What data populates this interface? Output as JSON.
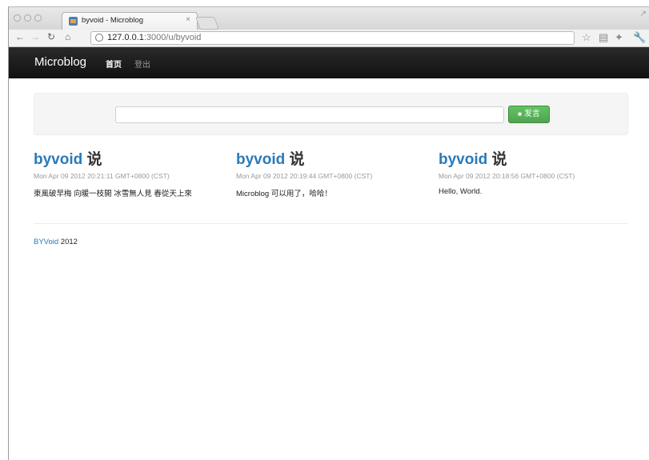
{
  "browser": {
    "tab_title": "byvoid - Microblog",
    "tab_close": "×",
    "url_host": "127.0.0.1",
    "url_rest": ":3000/u/byvoid"
  },
  "site": {
    "brand": "Microblog",
    "nav": {
      "home": "首页",
      "logout": "登出"
    },
    "composer": {
      "input_value": "",
      "submit_label": "发言"
    },
    "posts": [
      {
        "user": "byvoid",
        "verb": "说",
        "time": "Mon Apr 09 2012 20:21:11 GMT+0800 (CST)",
        "body": "東風破早梅 向暖一枝開 冰雪無人見 春從天上來"
      },
      {
        "user": "byvoid",
        "verb": "说",
        "time": "Mon Apr 09 2012 20:19:44 GMT+0800 (CST)",
        "body": "Microblog 可以用了，哈哈！"
      },
      {
        "user": "byvoid",
        "verb": "说",
        "time": "Mon Apr 09 2012 20:18:56 GMT+0800 (CST)",
        "body": "Hello, World."
      }
    ],
    "footer": {
      "link": "BYVoid",
      "year": " 2012"
    }
  }
}
